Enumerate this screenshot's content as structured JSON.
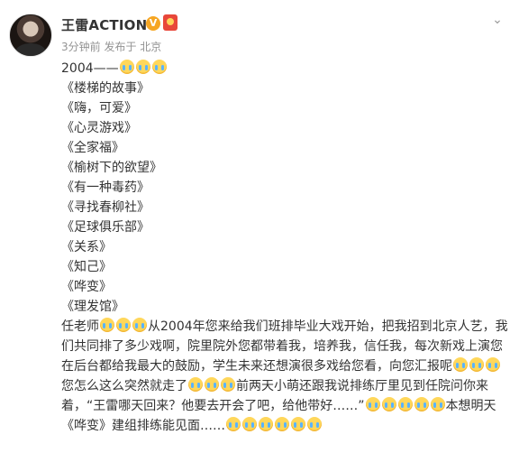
{
  "post": {
    "username": "王雷ACTION",
    "verified_icon": "verified-v-icon",
    "medal_icon": "member-medal-icon",
    "time": "3分钟前",
    "location": "发布于 北京",
    "more_icon": "chevron-down-icon"
  },
  "content": {
    "year_line": "2004——",
    "titles": [
      "《楼梯的故事》",
      "《嗨，可爱》",
      "《心灵游戏》",
      "《全家福》",
      "《榆树下的欲望》",
      "《有一种毒药》",
      "《寻找春柳社》",
      "《足球俱乐部》",
      "《关系》",
      "《知己》",
      "《哗变》",
      "《理发馆》"
    ],
    "para_a": "任老师",
    "para_b": "从2004年您来给我们班排毕业大戏开始，把我招到北京人艺，我们共同排了多少戏啊，院里院外您都带着我，培养我，信任我，每次新戏上演您在后台都给我最大的鼓励，学生未来还想演很多戏给您看，向您汇报呢",
    "para_c": "您怎么这么突然就走了",
    "para_d": "前两天小萌还跟我说排练厅里见到任院问你来着，“王雷哪天回来？他要去开会了吧，给他带好……”",
    "para_e": "本想明天《哗变》建组排练能见面……"
  },
  "emoji_name": "crying-face-emoji"
}
